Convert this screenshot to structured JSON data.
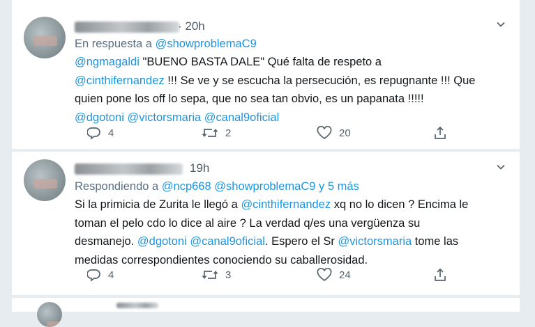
{
  "tweets": [
    {
      "time": "20h",
      "reply_prefix": "En respuesta a",
      "reply_to": [
        "@showproblemaC9"
      ],
      "reply_more": "",
      "body": {
        "l1a": "@ngmagaldi",
        "l1b": " \"BUENO BASTA DALE\" Qué falta de respeto a",
        "l2a": "@cinthifernandez",
        "l2b": " !!! Se ve y se escucha la persecución, es repugnante !!! Que",
        "l3": "quien pone los off lo sepa, que no sea tan obvio, es un papanata !!!!!",
        "l4a": "@dgotoni",
        "l4b": "@victorsmaria",
        "l4c": "@canal9oficial"
      },
      "replies": "4",
      "retweets": "2",
      "likes": "20"
    },
    {
      "time": "19h",
      "reply_prefix": "Respondiendo a",
      "reply_to": [
        "@ncp668",
        "@showproblemaC9"
      ],
      "reply_more": "y 5 más",
      "body": {
        "l1a": "Si la primicia de Zurita le llegó a ",
        "l1b": "@cinthifernandez",
        "l1c": " xq no lo dicen ? Encima le",
        "l2": "toman el pelo cdo lo dice al aire ? La verdad q/es una vergüenza su",
        "l3a": "desmanejo. ",
        "l3b": "@dgotoni",
        "l3c": "@canal9oficial",
        "l3d": ". Espero el Sr ",
        "l3e": "@victorsmaria",
        "l3f": " tome las",
        "l4": "medidas correspondientes conociendo su caballerosidad."
      },
      "replies": "4",
      "retweets": "3",
      "likes": "24"
    }
  ],
  "icons": [
    "chevron-down-icon",
    "reply-icon",
    "retweet-icon",
    "like-icon",
    "share-icon"
  ],
  "colors": {
    "mention": "#1b95e0",
    "text": "#14171a",
    "muted": "#5b7083",
    "background": "#e6ecf0"
  }
}
